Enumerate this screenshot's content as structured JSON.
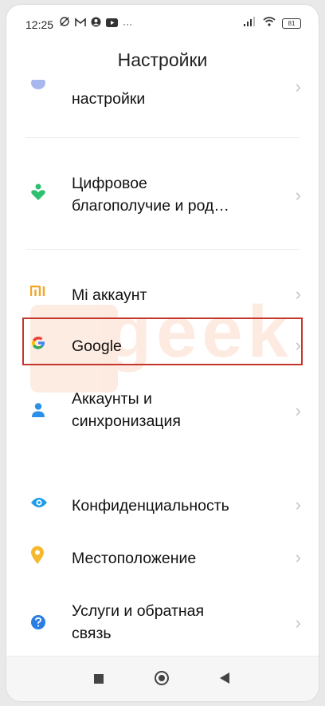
{
  "status_bar": {
    "time": "12:25",
    "more_indicator": "···",
    "battery_level": "81"
  },
  "header": {
    "title": "Настройки"
  },
  "settings": {
    "items": [
      {
        "label": "настройки",
        "icon": "settings-icon",
        "color": "#8aa0e8"
      },
      {
        "label": "Цифровое\nблагополучие и род…",
        "icon": "heart-person-icon",
        "color": "#2fbf71"
      },
      {
        "label": "Mi аккаунт",
        "icon": "mi-icon",
        "color": "#f5a623"
      },
      {
        "label": "Google",
        "icon": "google-icon",
        "color": "#4285f4"
      },
      {
        "label": "Аккаунты и\nсинхронизация",
        "icon": "person-icon",
        "color": "#2a90e8"
      },
      {
        "label": "Конфиденциальность",
        "icon": "eye-icon",
        "color": "#1e9be9"
      },
      {
        "label": "Местоположение",
        "icon": "location-pin-icon",
        "color": "#f5b82e"
      },
      {
        "label": "Услуги и обратная\nсвязь",
        "icon": "help-icon",
        "color": "#2a7de1"
      }
    ]
  },
  "watermark": {
    "text": "geek"
  },
  "highlight_color": "#c4362b"
}
